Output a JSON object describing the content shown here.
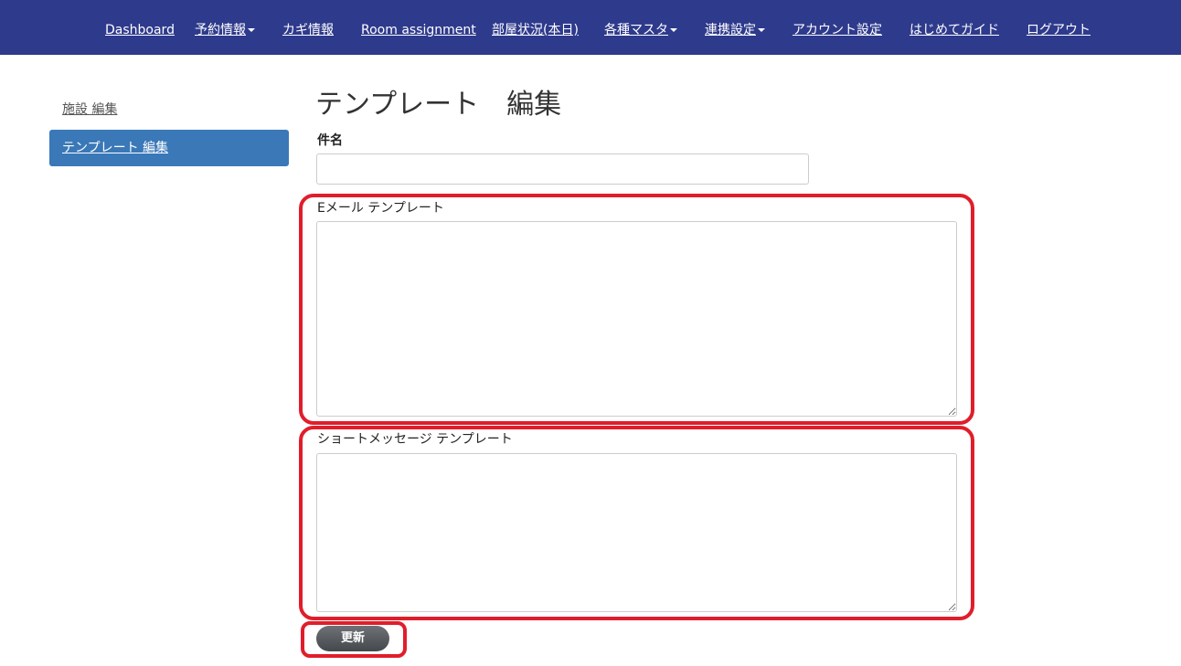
{
  "nav": {
    "items": [
      {
        "label": "Dashboard",
        "dropdown": false
      },
      {
        "label": "予約情報",
        "dropdown": true
      },
      {
        "label": "カギ情報",
        "dropdown": false
      },
      {
        "label": "Room assignment",
        "dropdown": false
      },
      {
        "label": "部屋状況(本日)",
        "dropdown": false
      },
      {
        "label": "各種マスタ",
        "dropdown": true
      },
      {
        "label": "連携設定",
        "dropdown": true
      },
      {
        "label": "アカウント設定",
        "dropdown": false
      },
      {
        "label": "はじめてガイド",
        "dropdown": false
      },
      {
        "label": "ログアウト",
        "dropdown": false
      }
    ]
  },
  "sidebar": {
    "items": [
      {
        "label": "施設 編集",
        "active": false
      },
      {
        "label": "テンプレート 編集",
        "active": true
      }
    ]
  },
  "main": {
    "title": "テンプレート　編集",
    "subject_label": "件名",
    "subject_value": "",
    "email_label": "Eメール テンプレート",
    "email_value": "",
    "sms_label": "ショートメッセージ テンプレート",
    "sms_value": "",
    "submit_label": "更新"
  },
  "colors": {
    "navbar": "#2e3a8c",
    "sidebar_active": "#3a78b8",
    "highlight": "#e01e2b",
    "button": "#55595d"
  }
}
